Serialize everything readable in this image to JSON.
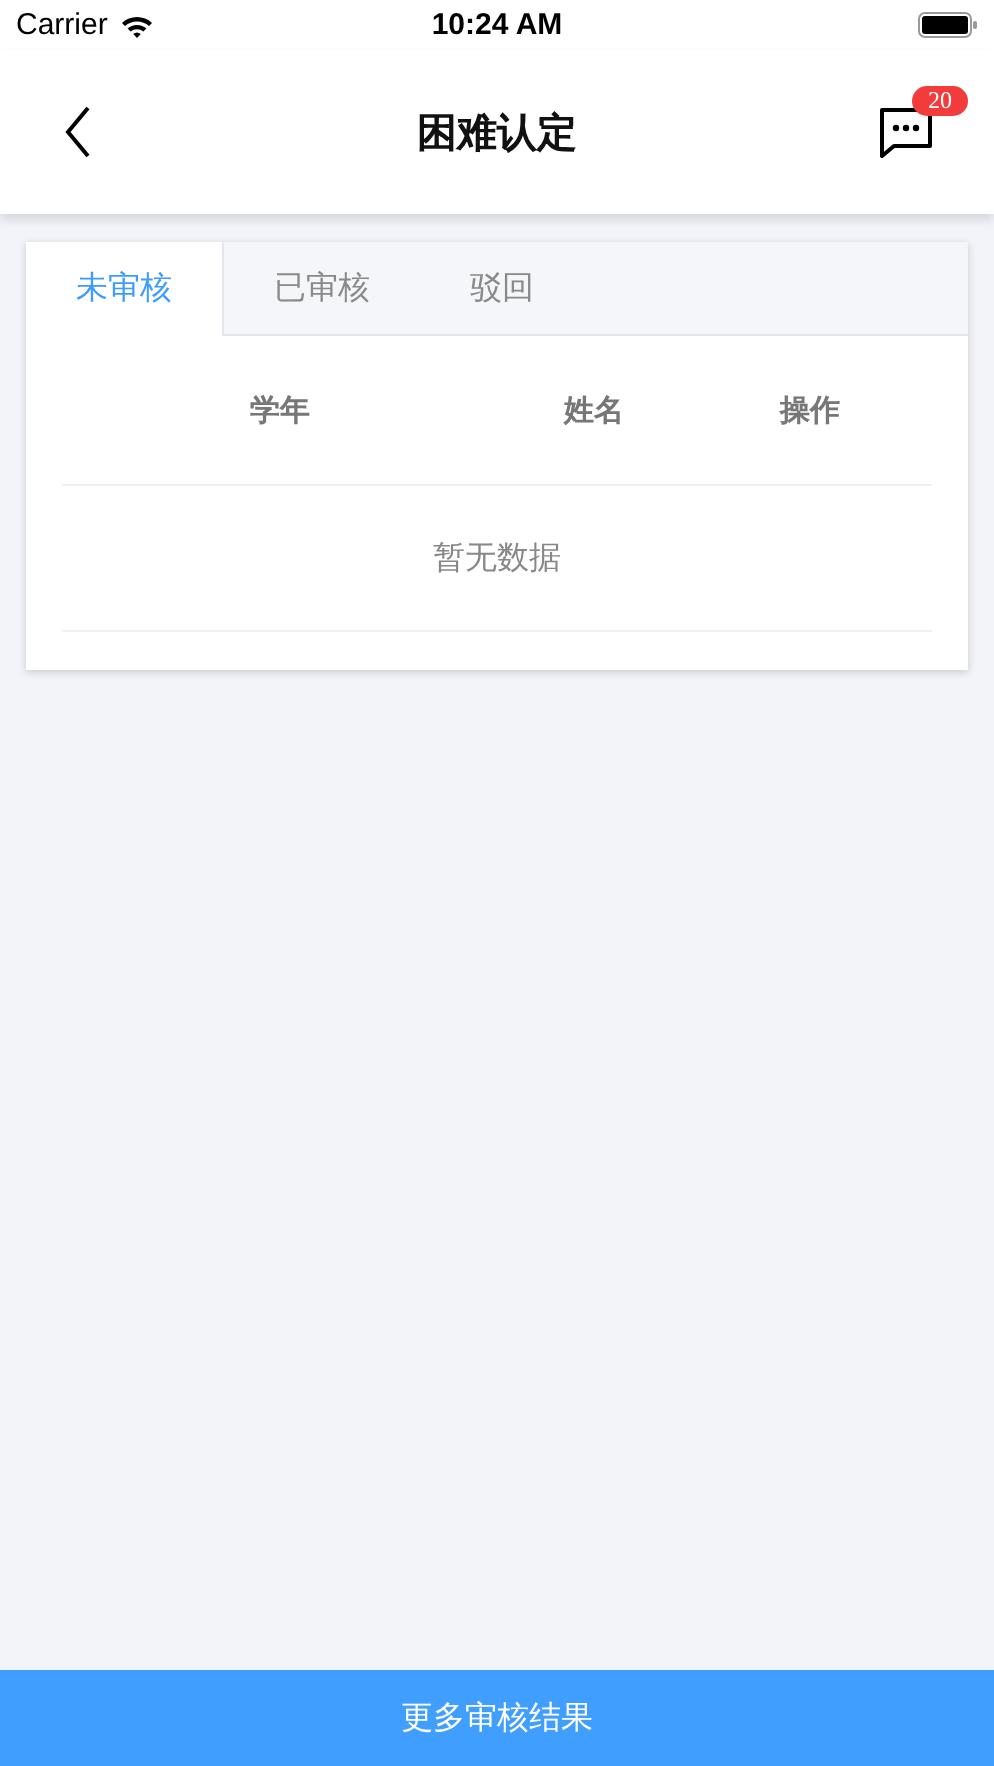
{
  "status_bar": {
    "carrier": "Carrier",
    "time": "10:24 AM"
  },
  "nav": {
    "title": "困难认定",
    "badge": "20"
  },
  "tabs": [
    {
      "label": "未审核",
      "selected": true
    },
    {
      "label": "已审核",
      "selected": false
    },
    {
      "label": "驳回",
      "selected": false
    }
  ],
  "table": {
    "columns": [
      "学年",
      "姓名",
      "操作"
    ],
    "empty_text": "暂无数据"
  },
  "footer_button": "更多审核结果"
}
